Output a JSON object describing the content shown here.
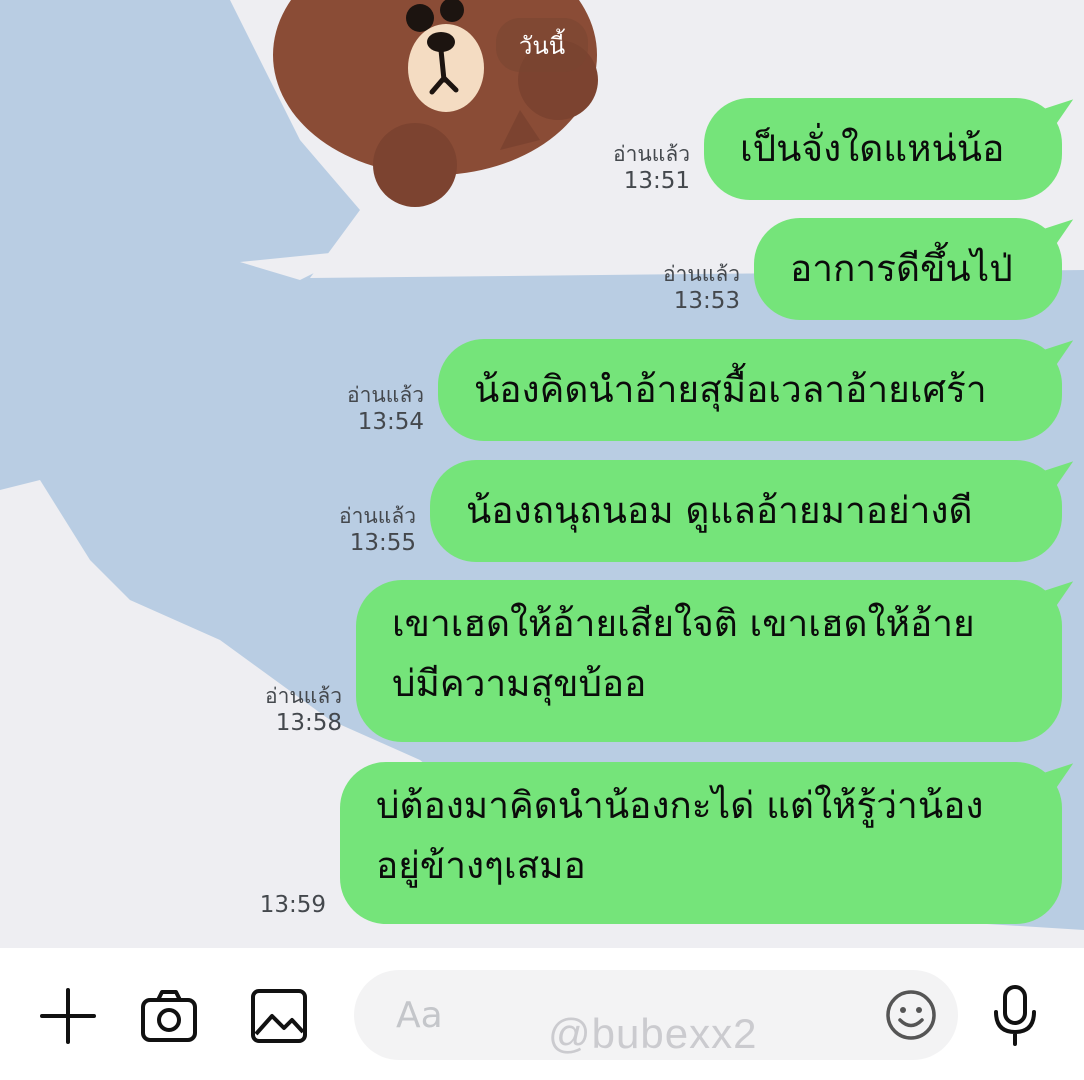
{
  "chat": {
    "date_chip": "วันนี้",
    "messages": [
      {
        "text": "เป็นจั่งใดแหน่น้อ",
        "read": "อ่านแล้ว",
        "time": "13:51"
      },
      {
        "text": "อาการดีขึ้นไป่",
        "read": "อ่านแล้ว",
        "time": "13:53"
      },
      {
        "text": "น้องคิดนำอ้ายสุมื้อเวลาอ้ายเศร้า",
        "read": "อ่านแล้ว",
        "time": "13:54"
      },
      {
        "text": "น้องถนุถนอม ดูแลอ้ายมาอย่างดี",
        "read": "อ่านแล้ว",
        "time": "13:55"
      },
      {
        "line1": "เขาเฮดให้อ้ายเสียใจติ เขาเฮดให้อ้าย",
        "line2": "บ่มีความสุขบ้ออ",
        "read": "อ่านแล้ว",
        "time": "13:58"
      },
      {
        "line1": "บ่ต้องมาคิดนำน้องกะได่ แต่ให้รู้ว่าน้อง",
        "line2": "อยู่ข้างๆเสมอ",
        "time": "13:59"
      }
    ]
  },
  "input_bar": {
    "placeholder": "Aa",
    "icons": [
      "plus-icon",
      "camera-icon",
      "image-icon",
      "emoji-icon",
      "microphone-icon"
    ]
  },
  "watermark": "@bubexx2",
  "colors": {
    "bubble": "#75e47a",
    "chat_bg": "#b9cde3",
    "cloud": "#eeeef2",
    "bear": "#8a4c36"
  }
}
